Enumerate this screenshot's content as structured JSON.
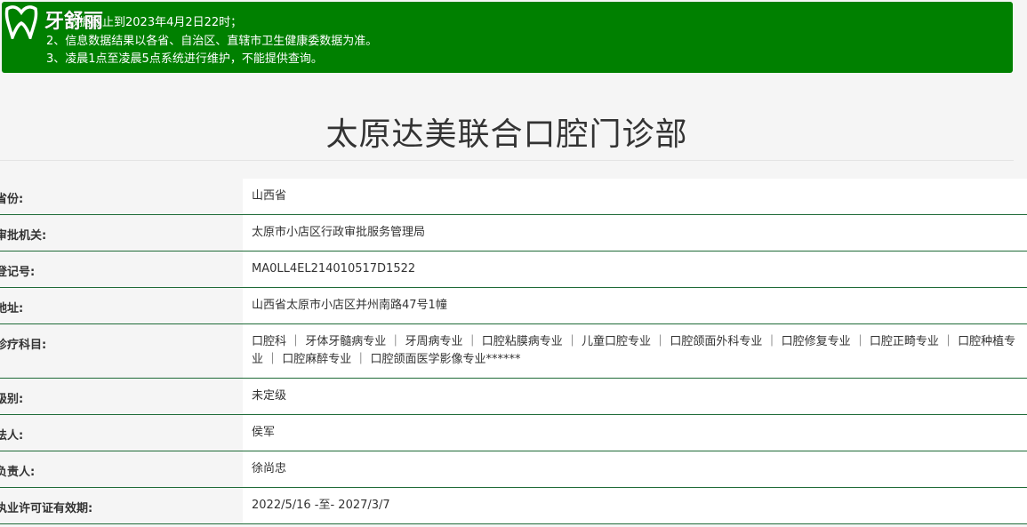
{
  "notice": {
    "line1": "数据截止到2023年4月2日22时；",
    "line2": "2、信息数据结果以各省、自治区、直辖市卫生健康委数据为准。",
    "line3": "3、凌晨1点至凌晨5点系统进行维护，不能提供查询。"
  },
  "logo": {
    "text": "牙舒丽"
  },
  "page_title": "太原达美联合口腔门诊部",
  "rows": [
    {
      "label": "省份:",
      "value": "山西省"
    },
    {
      "label": "审批机关:",
      "value": "太原市小店区行政审批服务管理局"
    },
    {
      "label": "登记号:",
      "value": "MA0LL4EL214010517D1522"
    },
    {
      "label": "地址:",
      "value": "山西省太原市小店区并州南路47号1幢"
    },
    {
      "label": "诊疗科目:",
      "value": "口腔科 ｜ 牙体牙髓病专业 ｜ 牙周病专业 ｜ 口腔粘膜病专业 ｜ 儿童口腔专业 ｜ 口腔颌面外科专业 ｜ 口腔修复专业 ｜ 口腔正畸专业 ｜ 口腔种植专业 ｜ 口腔麻醉专业 ｜ 口腔颌面医学影像专业******"
    },
    {
      "label": "级别:",
      "value": "未定级"
    },
    {
      "label": "法人:",
      "value": "侯军"
    },
    {
      "label": "负责人:",
      "value": "徐尚忠"
    },
    {
      "label": "执业许可证有效期:",
      "value": "2022/5/16 -至- 2027/3/7"
    }
  ],
  "colors": {
    "notice_bg": "#008000",
    "row_border": "#1f6b38"
  }
}
